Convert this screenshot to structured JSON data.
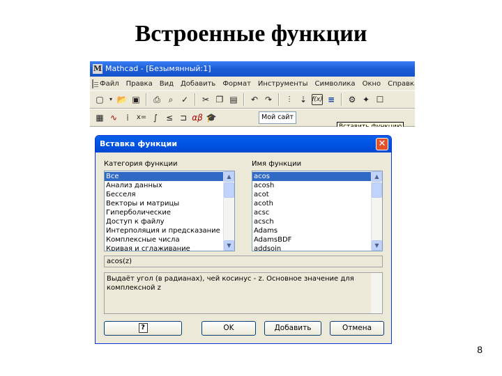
{
  "slide": {
    "title": "Встроенные функции",
    "number": "8"
  },
  "app": {
    "title": "Mathcad - [Безымянный:1]",
    "logo": "M",
    "menu": [
      "Файл",
      "Правка",
      "Вид",
      "Добавить",
      "Формат",
      "Инструменты",
      "Символика",
      "Окно",
      "Справка"
    ],
    "site_combo": "Мой сайт",
    "tooltip": "Вставить функцию",
    "toolbar_std_icons": [
      "new-document-icon",
      "open-folder-icon",
      "save-icon",
      "print-icon",
      "print-preview-icon",
      "spell-check-icon",
      "cut-icon",
      "copy-icon",
      "paste-icon",
      "undo-icon",
      "redo-icon",
      "align-icon",
      "insert-function-icon",
      "insert-unit-icon",
      "resource-icon",
      "component-icon"
    ],
    "toolbar_math_icons": [
      "calculator-icon",
      "graph-icon",
      "matrix-icon",
      "evaluation-icon",
      "calculus-icon",
      "boolean-icon",
      "programming-icon",
      "greek-icon",
      "symbolic-icon"
    ]
  },
  "dialog": {
    "title": "Вставка функции",
    "close_glyph": "✕",
    "category_label": "Категория функции",
    "function_label": "Имя функции",
    "categories": [
      "Все",
      "Анализ данных",
      "Бесселя",
      "Векторы и матрицы",
      "Гиперболические",
      "Доступ к файлу",
      "Интерполяция и предсказание",
      "Комплексные числа",
      "Кривая и сглаживание"
    ],
    "selected_category": "Все",
    "functions": [
      "acos",
      "acosh",
      "acot",
      "acoth",
      "acsc",
      "acsch",
      "Adams",
      "AdamsBDF",
      "addsoin"
    ],
    "selected_function": "acos",
    "syntax": "acos(z)",
    "description": "Выдаёт угол (в радианах), чей косинус - z. Основное значение для комплексной z",
    "help_glyph": "?",
    "buttons": {
      "ok": "OK",
      "add": "Добавить",
      "cancel": "Отмена"
    }
  }
}
